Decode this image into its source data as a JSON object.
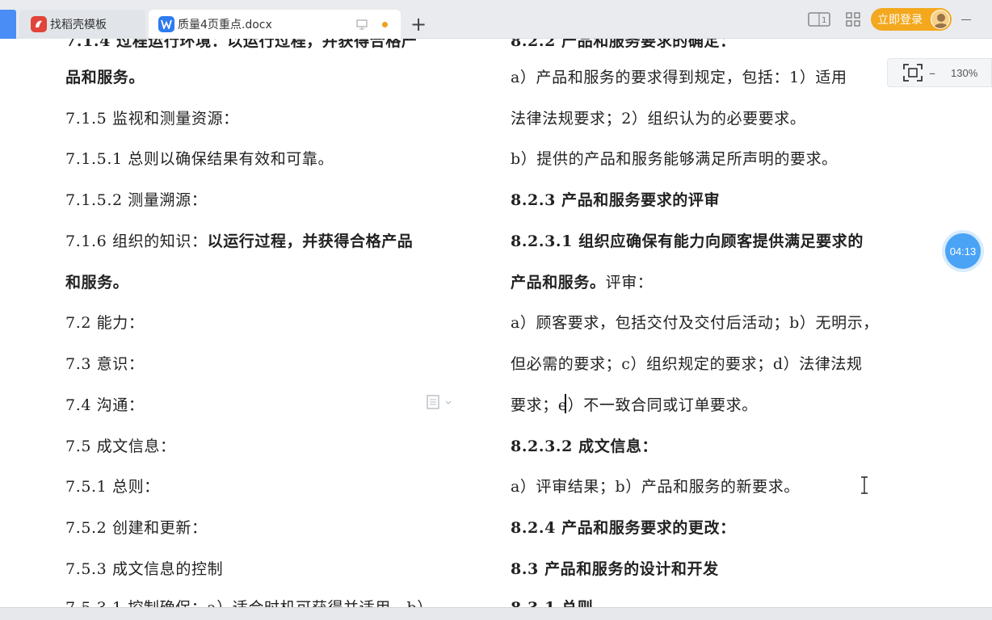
{
  "tabs": [
    {
      "label": "找稻壳模板",
      "icon": "docer-logo-icon"
    },
    {
      "label": "质量4页重点.docx",
      "icon": "writer-doc-icon",
      "modified": true
    }
  ],
  "header": {
    "login_label": "立即登录"
  },
  "zoom": {
    "minus": "–",
    "value": "130%"
  },
  "timer": "04:13",
  "document": {
    "left_column": [
      {
        "text": "品和服务。",
        "bold": true
      },
      {
        "text": "7.1.5 监视和测量资源："
      },
      {
        "text": "7.1.5.1 总则以确保结果有效和可靠。"
      },
      {
        "text": "7.1.5.2 测量溯源："
      },
      {
        "prefix": "7.1.6 组织的知识：",
        "text": "以运行过程，并获得合格产品",
        "bold_part": true
      },
      {
        "text": "和服务。",
        "bold": true
      },
      {
        "text": "7.2 能力："
      },
      {
        "text": "7.3 意识："
      },
      {
        "text": "7.4 沟通："
      },
      {
        "text": "7.5 成文信息："
      },
      {
        "text": "7.5.1 总则："
      },
      {
        "text": "7.5.2 创建和更新："
      },
      {
        "text": "7.5.3 成文信息的控制"
      }
    ],
    "right_column": [
      {
        "text": "a）产品和服务的要求得到规定，包括：1）适用"
      },
      {
        "text": "法律法规要求；2）组织认为的必要要求。"
      },
      {
        "text": "b）提供的产品和服务能够满足所声明的要求。"
      },
      {
        "text": "8.2.3 产品和服务要求的评审",
        "bold": true
      },
      {
        "text": "8.2.3.1 组织应确保有能力向顾客提供满足要求的",
        "bold": true
      },
      {
        "text": "产品和服务。",
        "bold_part": true,
        "suffix": "评审："
      },
      {
        "text": "a）顾客要求，包括交付及交付后活动；b）无明示，"
      },
      {
        "text": "但必需的要求；c）组织规定的要求；d）法律法规"
      },
      {
        "text": "要求；e）不一致合同或订单要求。"
      },
      {
        "text": "8.2.3.2 成文信息：",
        "bold": true
      },
      {
        "text": "a）评审结果；b）产品和服务的新要求。"
      },
      {
        "text": "8.2.4 产品和服务要求的更改：",
        "bold": true
      },
      {
        "text": "8.3 产品和服务的设计和开发",
        "bold": true
      }
    ]
  },
  "colors": {
    "accent": "#4a8ef5",
    "login": "#f3a81d",
    "timer": "#4aa3f5",
    "modified_dot": "#f0a020"
  }
}
